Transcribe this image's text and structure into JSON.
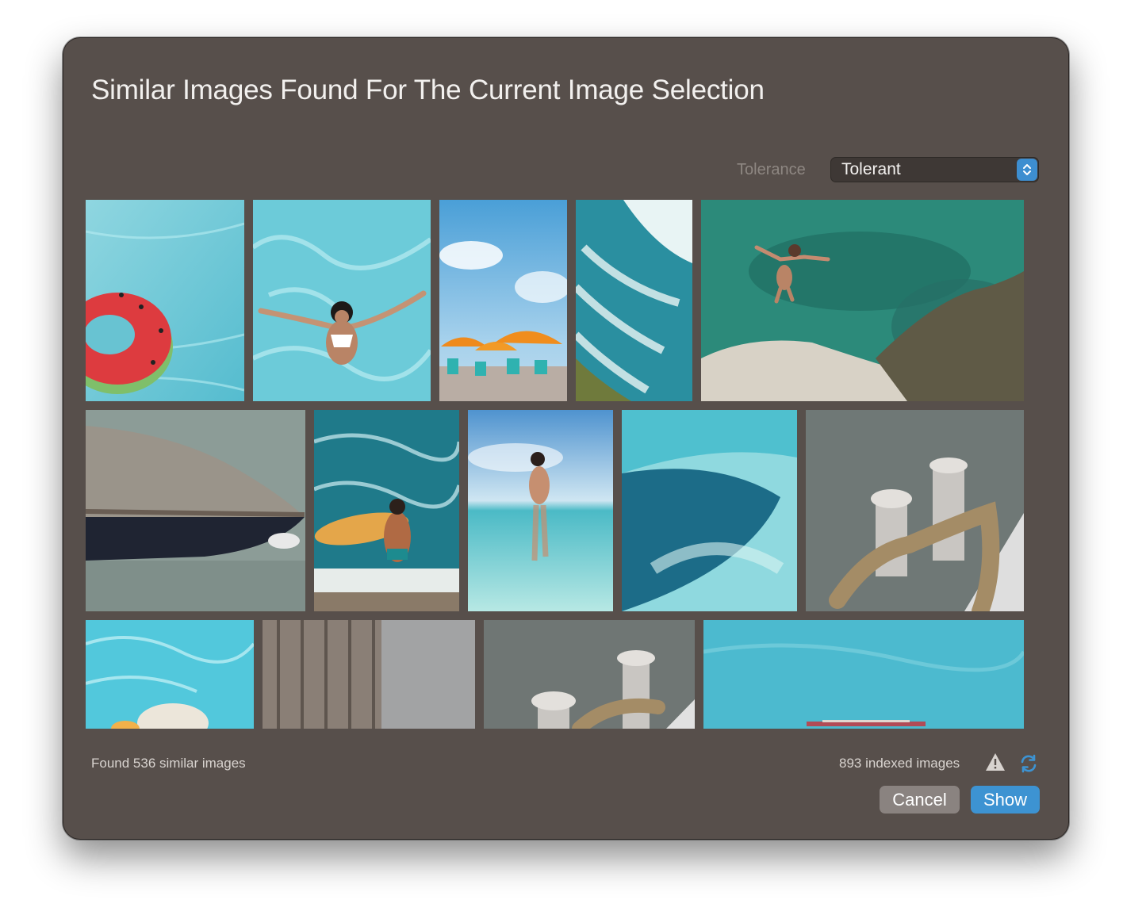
{
  "dialog": {
    "title": "Similar Images Found For The Current Image Selection"
  },
  "tolerance": {
    "label": "Tolerance",
    "selected": "Tolerant"
  },
  "footer": {
    "found_text": "Found 536 similar images",
    "indexed_text": "893 indexed images",
    "cancel_label": "Cancel",
    "show_label": "Show"
  },
  "colors": {
    "dialog_bg": "#574f4b",
    "accent": "#3d93d2",
    "cancel_bg": "#8a8380"
  },
  "icons": {
    "select_stepper": "chevron-up-down-icon",
    "warning": "warning-triangle-icon",
    "refresh": "refresh-icon"
  },
  "thumbnails": [
    {
      "subject": "watermelon float in pool"
    },
    {
      "subject": "woman swimming in pool"
    },
    {
      "subject": "orange beach umbrellas"
    },
    {
      "subject": "aerial ocean waves"
    },
    {
      "subject": "cliff jumper over sea"
    },
    {
      "subject": "wooden boat bow"
    },
    {
      "subject": "surfer with surfboard"
    },
    {
      "subject": "woman wading in sea"
    },
    {
      "subject": "turquoise shallow water"
    },
    {
      "subject": "mooring rope on bollard"
    },
    {
      "subject": "person in sun hat in pool"
    },
    {
      "subject": "weathered wooden planks"
    },
    {
      "subject": "rope on bollards"
    },
    {
      "subject": "boat on turquoise water"
    }
  ]
}
